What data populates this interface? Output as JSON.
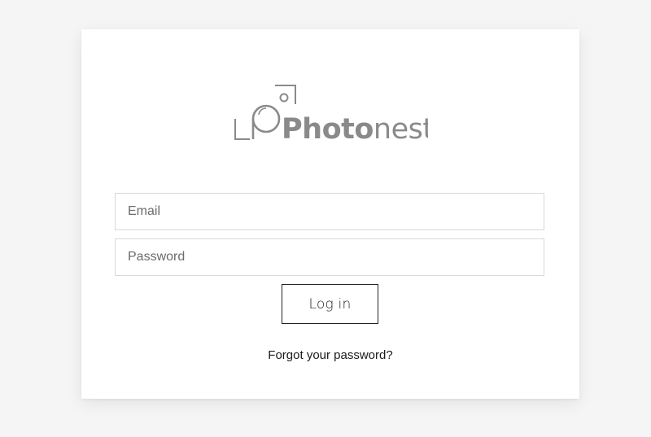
{
  "brand": {
    "logo_prefix": "Photo",
    "logo_suffix": "nesto",
    "logo_color": "#8a8a8a"
  },
  "form": {
    "email_placeholder": "Email",
    "password_placeholder": "Password",
    "login_label": "Log in",
    "forgot_label": "Forgot your password?"
  },
  "colors": {
    "background": "#f5f5f5",
    "card": "#ffffff",
    "field_border": "#d9d9d9",
    "button_border": "#222222",
    "text": "#1a1a1a"
  }
}
